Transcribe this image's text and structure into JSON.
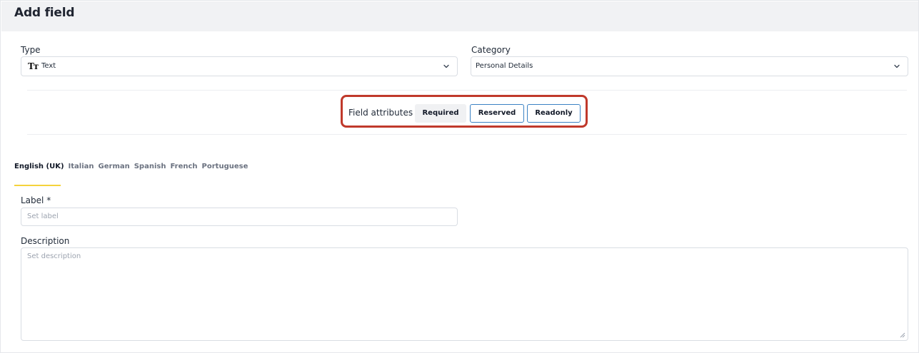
{
  "header": {
    "title": "Add field"
  },
  "type_field": {
    "label": "Type",
    "value": "Text",
    "icon": "text-type-icon"
  },
  "category_field": {
    "label": "Category",
    "value": "Personal Details"
  },
  "attributes": {
    "label": "Field attributes",
    "buttons": [
      {
        "label": "Required",
        "state": "active"
      },
      {
        "label": "Reserved",
        "state": "outlined"
      },
      {
        "label": "Readonly",
        "state": "outlined"
      }
    ],
    "highlight_color": "#c0392b"
  },
  "languages": {
    "tabs": [
      "English (UK)",
      "Italian",
      "German",
      "Spanish",
      "French",
      "Portuguese"
    ],
    "active": "English (UK)",
    "underline_color": "#f5d33c"
  },
  "label_field": {
    "label": "Label *",
    "placeholder": "Set label"
  },
  "description_field": {
    "label": "Description",
    "placeholder": "Set description"
  }
}
